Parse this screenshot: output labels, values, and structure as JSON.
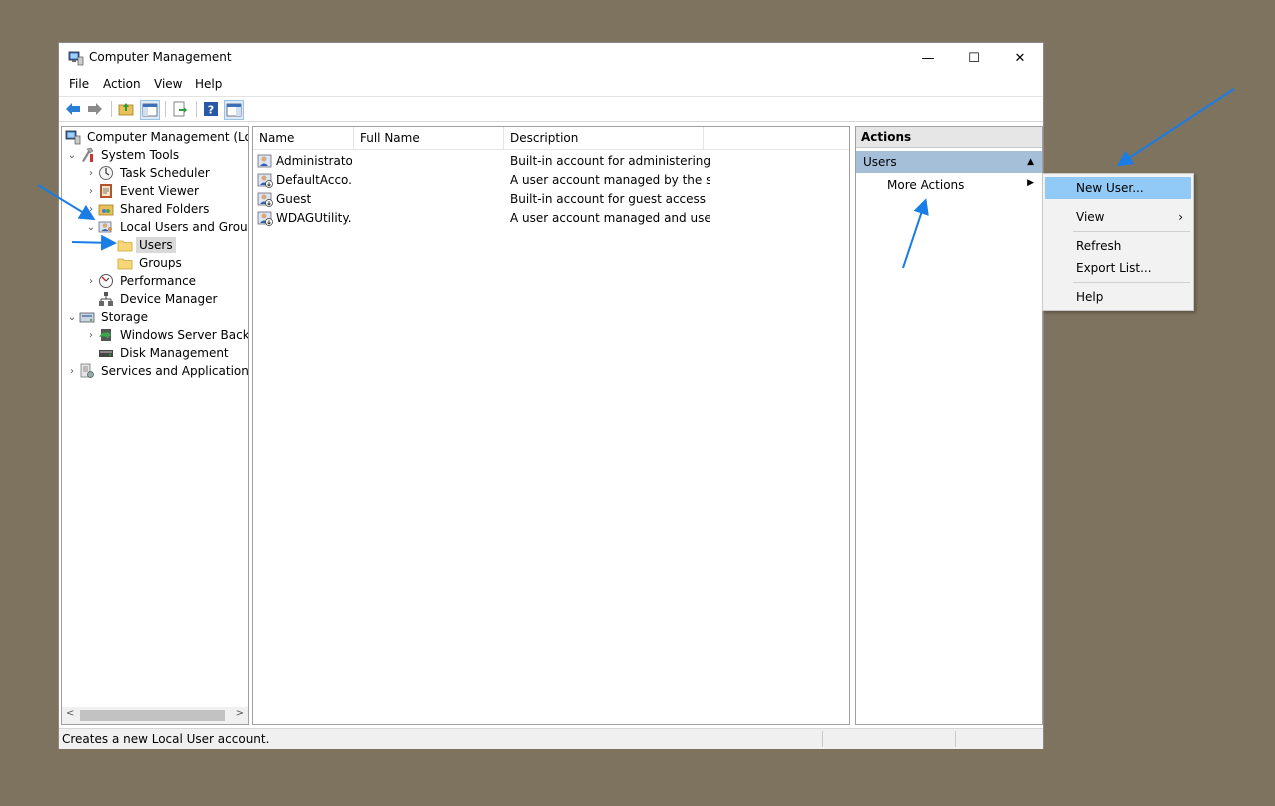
{
  "window": {
    "title": "Computer Management"
  },
  "window_controls": {
    "minimize": "—",
    "maximize": "☐",
    "close": "✕"
  },
  "menu": [
    "File",
    "Action",
    "View",
    "Help"
  ],
  "tree": {
    "items": [
      {
        "label": "Computer Management (Local",
        "expander": "",
        "icon": "computer-management-icon"
      },
      {
        "label": "System Tools",
        "expander": "⌄",
        "icon": "system-tools-icon"
      },
      {
        "label": "Task Scheduler",
        "expander": "›",
        "icon": "task-scheduler-icon"
      },
      {
        "label": "Event Viewer",
        "expander": "›",
        "icon": "event-viewer-icon"
      },
      {
        "label": "Shared Folders",
        "expander": "›",
        "icon": "shared-folders-icon"
      },
      {
        "label": "Local Users and Groups",
        "expander": "⌄",
        "icon": "local-users-groups-icon"
      },
      {
        "label": "Users",
        "expander": "",
        "icon": "folder-icon",
        "selected": true
      },
      {
        "label": "Groups",
        "expander": "",
        "icon": "folder-icon"
      },
      {
        "label": "Performance",
        "expander": "›",
        "icon": "performance-icon"
      },
      {
        "label": "Device Manager",
        "expander": "",
        "icon": "device-manager-icon"
      },
      {
        "label": "Storage",
        "expander": "⌄",
        "icon": "storage-icon"
      },
      {
        "label": "Windows Server Backup",
        "expander": "›",
        "icon": "server-backup-icon"
      },
      {
        "label": "Disk Management",
        "expander": "",
        "icon": "disk-management-icon"
      },
      {
        "label": "Services and Applications",
        "expander": "›",
        "icon": "services-applications-icon"
      }
    ],
    "scroll_left": "<",
    "scroll_right": ">"
  },
  "list": {
    "columns": [
      "Name",
      "Full Name",
      "Description"
    ],
    "rows": [
      {
        "name": "Administrator",
        "full_name": "",
        "description": "Built-in account for administering..."
      },
      {
        "name": "DefaultAcco...",
        "full_name": "",
        "description": "A user account managed by the s..."
      },
      {
        "name": "Guest",
        "full_name": "",
        "description": "Built-in account for guest access t..."
      },
      {
        "name": "WDAGUtility...",
        "full_name": "",
        "description": "A user account managed and use..."
      }
    ]
  },
  "actions": {
    "title": "Actions",
    "group": "Users",
    "group_arrow": "▲",
    "more_actions": "More Actions",
    "more_arrow": "▶"
  },
  "context_menu": {
    "items": [
      {
        "label": "New User...",
        "highlighted": true
      },
      {
        "label": "View",
        "arrow": "›"
      },
      {
        "label": "Refresh"
      },
      {
        "label": "Export List..."
      },
      {
        "label": "Help"
      }
    ]
  },
  "status": {
    "text": "Creates a new Local User account."
  },
  "colors": {
    "desktop": "#7d735e",
    "annotation_arrow": "#1a7de6",
    "menu_highlight": "#91c9f7",
    "actions_group": "#a6bfd8"
  }
}
